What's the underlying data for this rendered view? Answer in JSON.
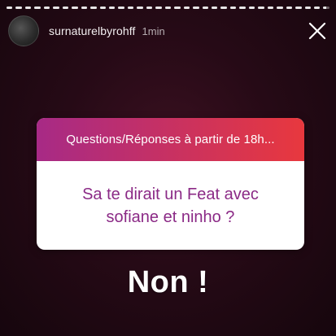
{
  "story": {
    "progress": [
      1.0,
      1.0,
      1.0,
      1.0,
      1.0,
      1.0,
      1.0,
      1.0,
      1.0,
      1.0,
      1.0,
      1.0,
      1.0,
      1.0,
      1.0,
      1.0,
      1.0,
      1.0,
      1.0,
      1.0,
      1.0,
      1.0,
      1.0,
      1.0,
      1.0,
      1.0,
      1.0,
      1.0,
      1.0,
      1.0,
      1.0,
      1.0,
      1.0,
      1.0,
      0.5
    ],
    "username": "surnaturelbyrohff",
    "time": "1min",
    "close_icon": "close-icon"
  },
  "question": {
    "header": "Questions/Réponses à partir de 18h...",
    "text": "Sa te dirait un Feat avec\nsofiane  et ninho ?",
    "colors": {
      "gradient_start": "#a72a86",
      "gradient_end": "#e8383e",
      "question_text": "#8b2a86"
    }
  },
  "answer": {
    "text": "Non !"
  }
}
